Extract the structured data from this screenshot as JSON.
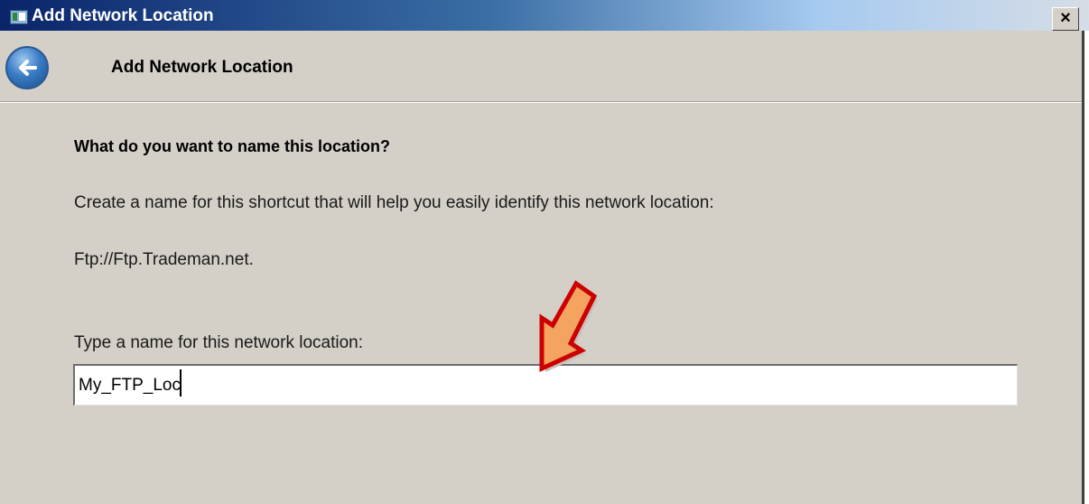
{
  "window": {
    "title": "Add Network Location",
    "close_label": "×"
  },
  "header": {
    "title": "Add Network Location",
    "back_icon": "back-arrow-icon"
  },
  "content": {
    "question": "What do you want to name this location?",
    "description": "Create a name for this shortcut that will help you easily identify this network location:",
    "location": "Ftp://Ftp.Trademan.net.",
    "field_label": "Type a name for this network location:",
    "name_value": "My_FTP_Loc"
  },
  "annotation": {
    "icon": "pointer-arrow-icon",
    "fill_color": "#f4a460",
    "stroke_color": "#cc0000"
  },
  "colors": {
    "dialog_background": "#d4d0c8",
    "title_bar": "#0a246a"
  }
}
